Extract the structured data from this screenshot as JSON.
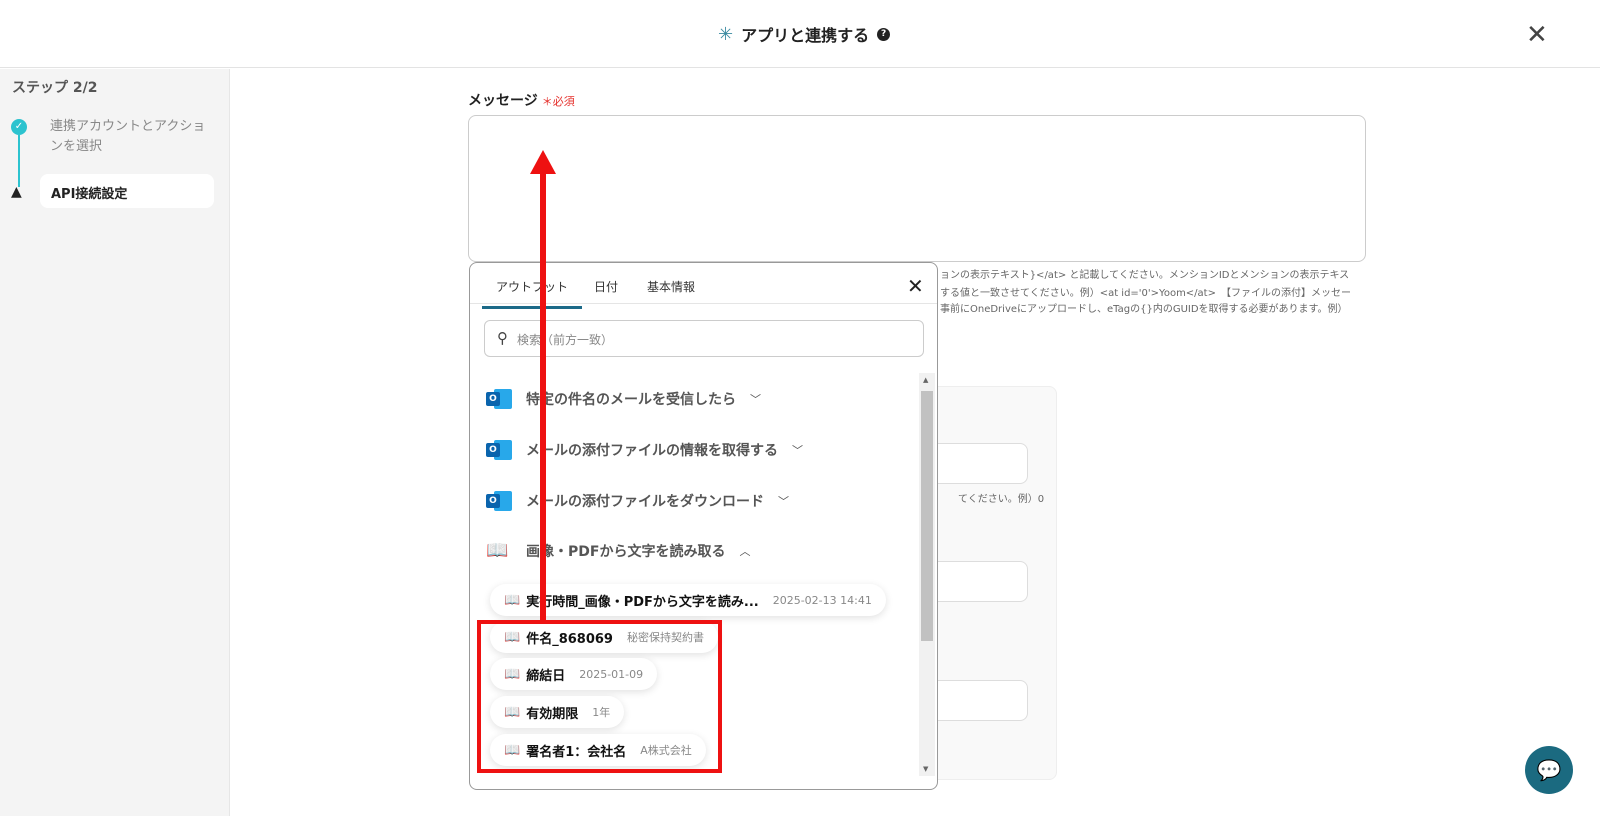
{
  "header": {
    "title": "アプリと連携する",
    "help": "?"
  },
  "sidebar": {
    "step": "ステップ 2/2",
    "steps": [
      {
        "label": "連携アカウントとアクションを選択",
        "status": "done"
      },
      {
        "label": "API接続設定",
        "status": "warning"
      }
    ]
  },
  "form": {
    "message_label": "メッセージ",
    "required": "＊必須",
    "help_lines": [
      "ョンの表示テキスト}</at> と記載してください。メンションIDとメンションの表示テキス",
      "する値と一致させてください。例）<at id='0'>Yoom</at>　【ファイルの添付】メッセー",
      "事前にOneDriveにアップロードし、eTagの{}内のGUIDを取得する必要があります。例）"
    ],
    "behind_help": "てください。例）0"
  },
  "popup": {
    "tabs": [
      "アウトプット",
      "日付",
      "基本情報"
    ],
    "search_placeholder": "検索（前方一致）",
    "groups": [
      {
        "label": "特定の件名のメールを受信したら",
        "icon": "outlook"
      },
      {
        "label": "メールの添付ファイルの情報を取得する",
        "icon": "outlook"
      },
      {
        "label": "メールの添付ファイルをダウンロード",
        "icon": "outlook"
      },
      {
        "label": "画像・PDFから文字を読み取る",
        "icon": "ocr-book"
      }
    ],
    "items": [
      {
        "key": "実行時間_画像・PDFから文字を読み...",
        "value": "2025-02-13 14:41"
      },
      {
        "key": "件名_868069",
        "value": "秘密保持契約書"
      },
      {
        "key": "締結日",
        "value": "2025-01-09"
      },
      {
        "key": "有効期限",
        "value": "1年"
      },
      {
        "key": "署名者1：会社名",
        "value": "A株式会社"
      }
    ]
  },
  "colors": {
    "accent": "#1c6a88",
    "annotation": "#e11111",
    "step_done": "#2cc3cf"
  }
}
